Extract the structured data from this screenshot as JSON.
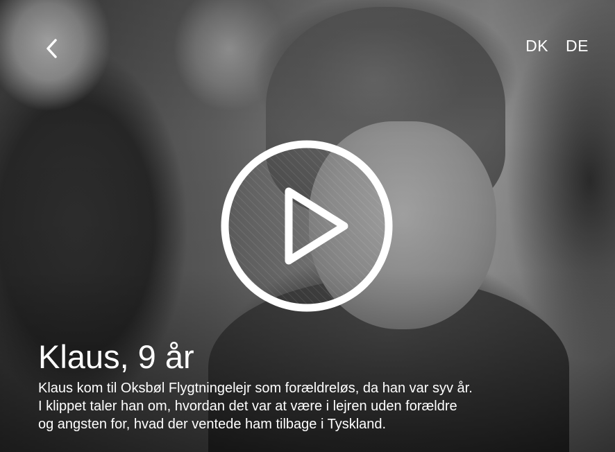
{
  "header": {
    "back_icon": "chevron-left-icon",
    "languages": [
      "DK",
      "DE"
    ]
  },
  "player": {
    "play_icon": "play-icon"
  },
  "caption": {
    "title": "Klaus, 9 år",
    "description_lines": [
      "Klaus kom til Oksbøl Flygtningelejr som forældreløs, da han var syv år.",
      "I klippet taler han om, hvordan det var at være i lejren uden forældre",
      "og angsten for, hvad der ventede ham tilbage i Tyskland."
    ]
  },
  "colors": {
    "foreground": "#ffffff",
    "photo_tone": "#6e6e6e"
  }
}
